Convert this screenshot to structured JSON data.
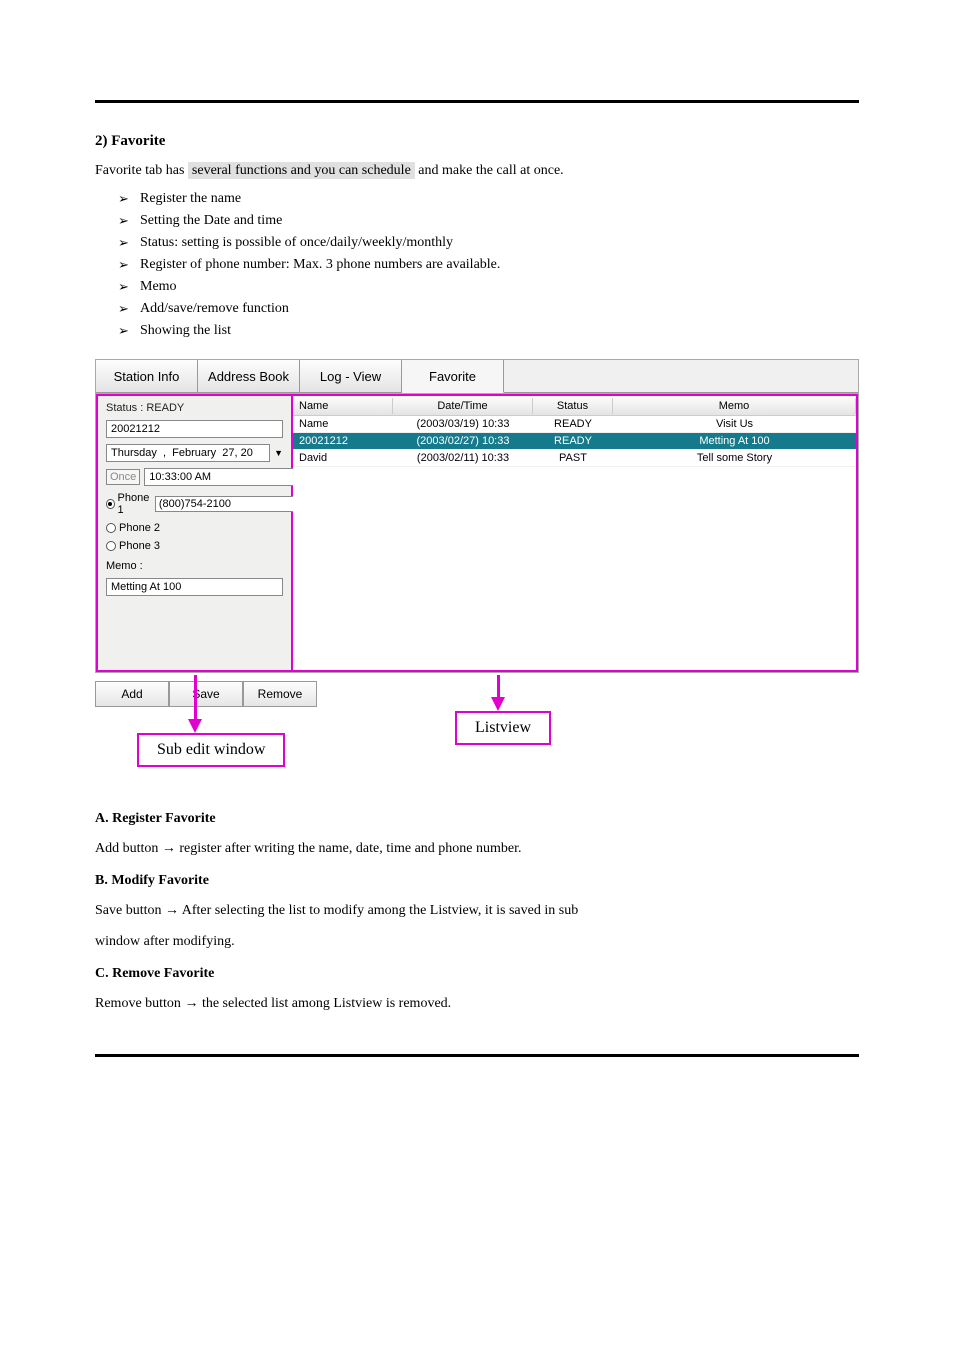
{
  "section": {
    "title": "2)  Favorite",
    "intro_prefix": "Favorite tab has ",
    "intro_highlight": "several functions and you can schedule",
    "intro_suffix": " and make the call at once.",
    "bullets": [
      "Register the name",
      "Setting the Date and time",
      "Status: setting is possible of once/daily/weekly/monthly",
      "Register of phone number: Max. 3 phone numbers are available.",
      "Memo",
      "Add/save/remove function",
      "Showing the list"
    ]
  },
  "tabs": [
    "Station Info",
    "Address Book",
    "Log - View",
    "Favorite"
  ],
  "activeTabIndex": 3,
  "left": {
    "status": "Status : READY",
    "name": "20021212",
    "date": "Thursday  ,  February  27, 20",
    "once": "Once",
    "time": "10:33:00 AM",
    "phone1_label": "Phone 1",
    "phone1_value": "(800)754-2100",
    "phone2_label": "Phone 2",
    "phone3_label": "Phone 3",
    "memo_label": "Memo :",
    "memo_value": "Metting At 100"
  },
  "listHeaders": {
    "name": "Name",
    "dt": "Date/Time",
    "status": "Status",
    "memo": "Memo"
  },
  "listRows": [
    {
      "name": "Name",
      "dt": "(2003/03/19) 10:33",
      "status": "READY",
      "memo": "Visit Us",
      "selected": false
    },
    {
      "name": "20021212",
      "dt": "(2003/02/27) 10:33",
      "status": "READY",
      "memo": "Metting At 100",
      "selected": true
    },
    {
      "name": "David",
      "dt": "(2003/02/11) 10:33",
      "status": "PAST",
      "memo": "Tell some Story",
      "selected": false
    }
  ],
  "buttons": {
    "add": "Add",
    "save": "Save",
    "remove": "Remove"
  },
  "callouts": {
    "listview": "Listview",
    "subedit": "Sub edit window"
  },
  "below": {
    "a_head": "A.  Register Favorite",
    "a_line_prefix": "Add button ",
    "a_line_suffix": " register after writing the name, date, time and phone number.",
    "b_head": "B.  Modify Favorite",
    "b_line_prefix": "Save button ",
    "b_line_suffix": " After selecting the list to modify among the Listview, it is saved in sub",
    "b_line2": "window after modifying.",
    "c_head": "C.  Remove Favorite",
    "c_line_prefix": "Remove button ",
    "c_line_suffix": " the selected list among Listview is removed.",
    "arrow": "→"
  }
}
